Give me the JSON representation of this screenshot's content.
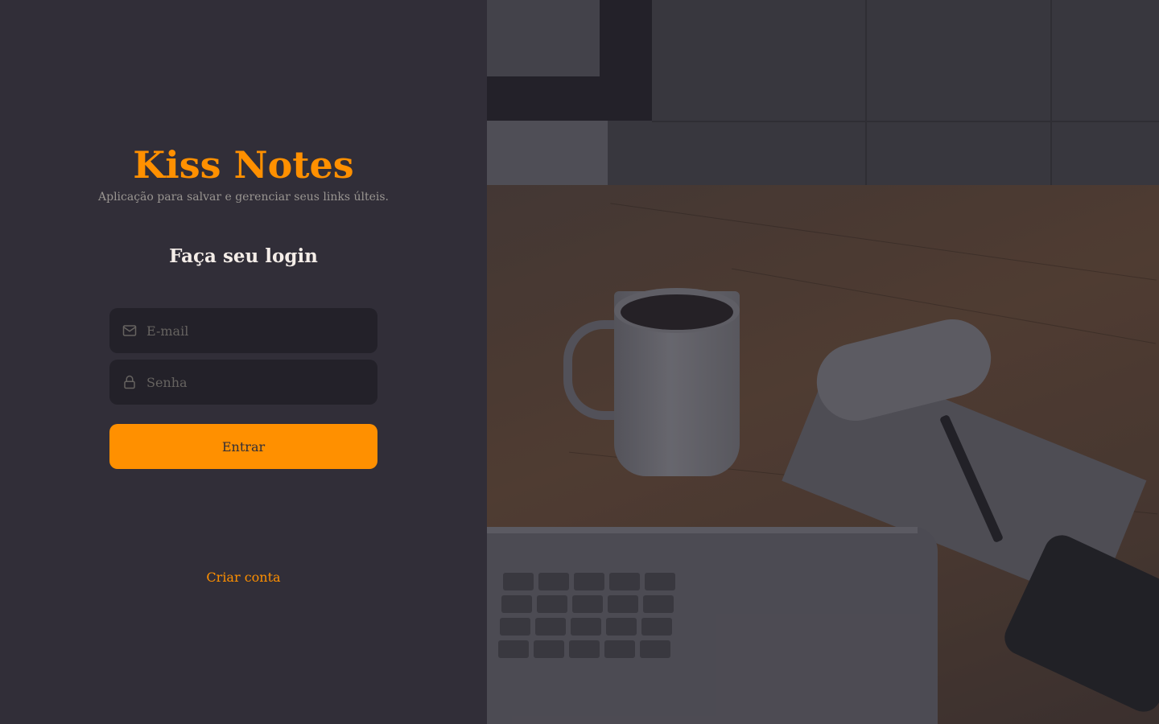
{
  "brand": {
    "title": "Kiss Notes",
    "subtitle": "Aplicação para salvar e gerenciar seus links últeis."
  },
  "login": {
    "heading": "Faça seu login",
    "email_placeholder": "E-mail",
    "email_icon": "mail-icon",
    "password_placeholder": "Senha",
    "password_icon": "lock-icon",
    "submit_label": "Entrar"
  },
  "footer": {
    "create_account_label": "Criar conta"
  },
  "colors": {
    "accent": "#ff9000",
    "background": "#312e38",
    "input_background": "#232129",
    "text": "#f4ede8",
    "muted": "#999591"
  }
}
